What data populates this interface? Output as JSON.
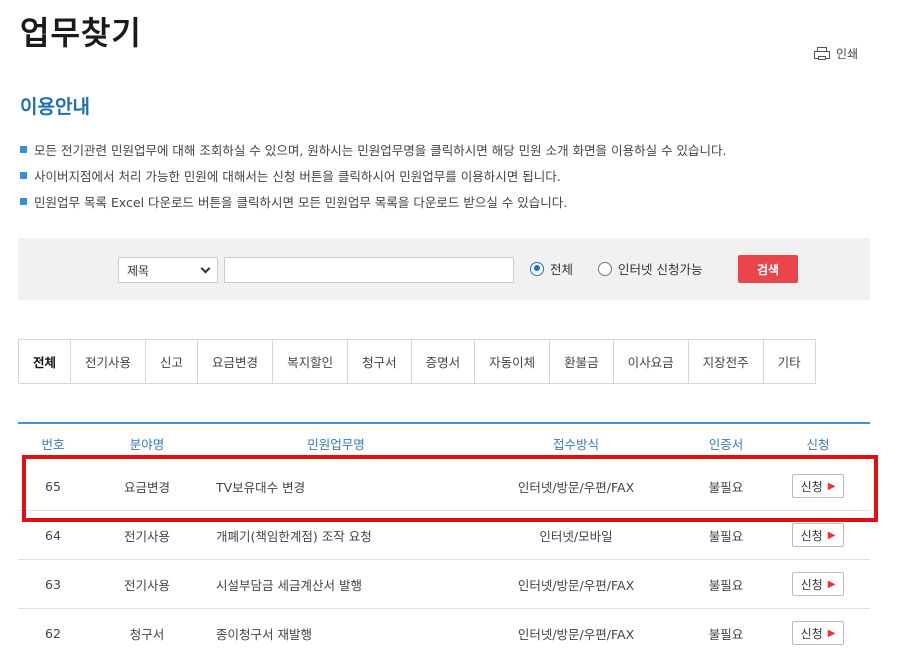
{
  "header": {
    "title": "업무찾기",
    "print_label": "인쇄"
  },
  "guide": {
    "title": "이용안내",
    "notes": [
      "모든 전기관련 민원업무에 대해 조회하실 수 있으며, 원하시는 민원업무명을 클릭하시면 해당 민원 소개 화면을 이용하실 수 있습니다.",
      "사이버지점에서 처리 가능한 민원에 대해서는 신청 버튼을 클릭하시어 민원업무를 이용하시면 됩니다.",
      "민원업무 목록 Excel 다운로드 버튼을 클릭하시면 모든 민원업무 목록을 다운로드 받으실 수 있습니다."
    ]
  },
  "search": {
    "select_value": "제목",
    "input_value": "",
    "radio_all": "전체",
    "radio_online": "인터넷 신청가능",
    "button": "검색"
  },
  "tabs": [
    "전체",
    "전기사용",
    "신고",
    "요금변경",
    "복지할인",
    "청구서",
    "증명서",
    "자동이체",
    "환불금",
    "이사요금",
    "지장전주",
    "기타"
  ],
  "table": {
    "headers": [
      "번호",
      "분야명",
      "민원업무명",
      "접수방식",
      "인증서",
      "신청"
    ],
    "rows": [
      {
        "no": "65",
        "category": "요금변경",
        "name": "TV보유대수 변경",
        "method": "인터넷/방문/우편/FAX",
        "cert": "불필요",
        "apply": "신청"
      },
      {
        "no": "64",
        "category": "전기사용",
        "name": "개폐기(책임한계점) 조작 요청",
        "method": "인터넷/모바일",
        "cert": "불필요",
        "apply": "신청"
      },
      {
        "no": "63",
        "category": "전기사용",
        "name": "시설부담금 세금계산서 발행",
        "method": "인터넷/방문/우편/FAX",
        "cert": "불필요",
        "apply": "신청"
      },
      {
        "no": "62",
        "category": "청구서",
        "name": "종이청구서 재발행",
        "method": "인터넷/방문/우편/FAX",
        "cert": "불필요",
        "apply": "신청"
      }
    ]
  },
  "colors": {
    "accent_blue": "#1f6fb2",
    "search_red": "#e9454a",
    "highlight_red": "#e01010"
  }
}
